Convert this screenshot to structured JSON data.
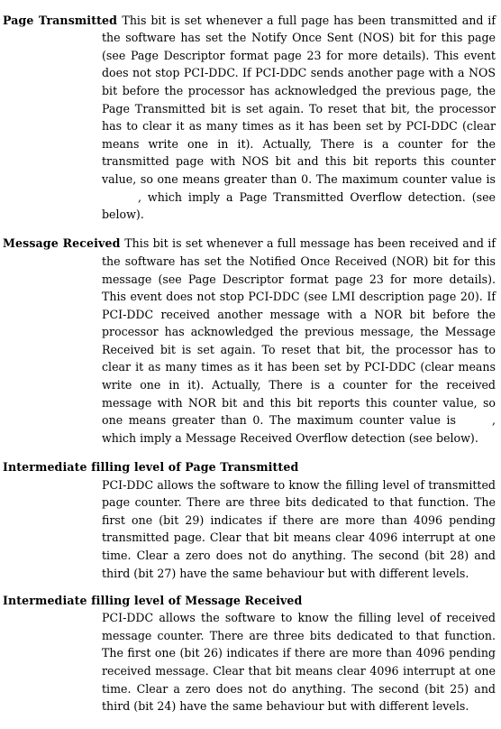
{
  "document": {
    "kind": "technical-reference-page",
    "font_style": "serif",
    "text_color": "#000000",
    "background_color": "#ffffff"
  },
  "entries": [
    {
      "id": "page-transmitted",
      "layout": "hanging-term",
      "term": "Page Transmitted",
      "body_part_1": "This bit is set whenever a full page has been transmitted and if the software has set the Notify Once Sent (NOS) bit for this page (see Page Descriptor format page 23 for more details). This event does not stop PCI-DDC. If PCI-DDC sends another page with a NOS bit before the processor has acknowledged the previous page, the Page Transmitted bit is set again. To reset that bit, the processor has to clear it as many times as it has been set by PCI-DDC (clear means write one in it). Actually, There is a counter for the transmitted page with NOS bit and this bit reports this counter value, so one means greater than 0. The maximum counter value is",
      "body_part_2": ", which imply a Page Transmitted Overflow detection. (see below)."
    },
    {
      "id": "message-received",
      "layout": "hanging-term",
      "term": "Message Received",
      "body_part_1": "This bit is set whenever a full message has been received and if the software has set the Notified Once Received (NOR) bit for this message (see Page Descriptor format page 23 for more details). This event does not stop PCI-DDC (see LMI description page 20). If PCI-DDC received another message with a NOR bit before the processor has acknowledged the previous message, the Message Received bit is set again. To reset that bit, the processor has to clear it as many times as it has been set by PCI-DDC (clear means write one in it). Actually, There is a counter for the received message with NOR bit and this bit reports this counter value, so one means greater than 0. The maximum counter value is",
      "body_part_2": ", which imply a Message Received Overflow detection (see below)."
    },
    {
      "id": "intermediate-filling-page-transmitted",
      "layout": "block-heading",
      "term": "Intermediate filling level of Page Transmitted",
      "body": "PCI-DDC allows the software to know the filling level of transmitted page counter. There are three bits dedicated to that function. The first one (bit 29) indicates if there are more than 4096 pending transmitted page. Clear that bit means clear 4096 interrupt at one time. Clear a zero does not do anything. The second (bit 28) and third (bit 27) have the same behaviour but with different levels."
    },
    {
      "id": "intermediate-filling-message-received",
      "layout": "block-heading",
      "term": "Intermediate filling level of Message Received",
      "body": "PCI-DDC allows the software to know the filling level of received message counter. There are three bits dedicated to that function. The first one (bit 26) indicates if there are more than 4096 pending received message. Clear that bit means clear 4096 interrupt at one time. Clear a zero does not do anything. The second (bit 25) and third (bit 24) have the same behaviour but with different levels."
    }
  ]
}
